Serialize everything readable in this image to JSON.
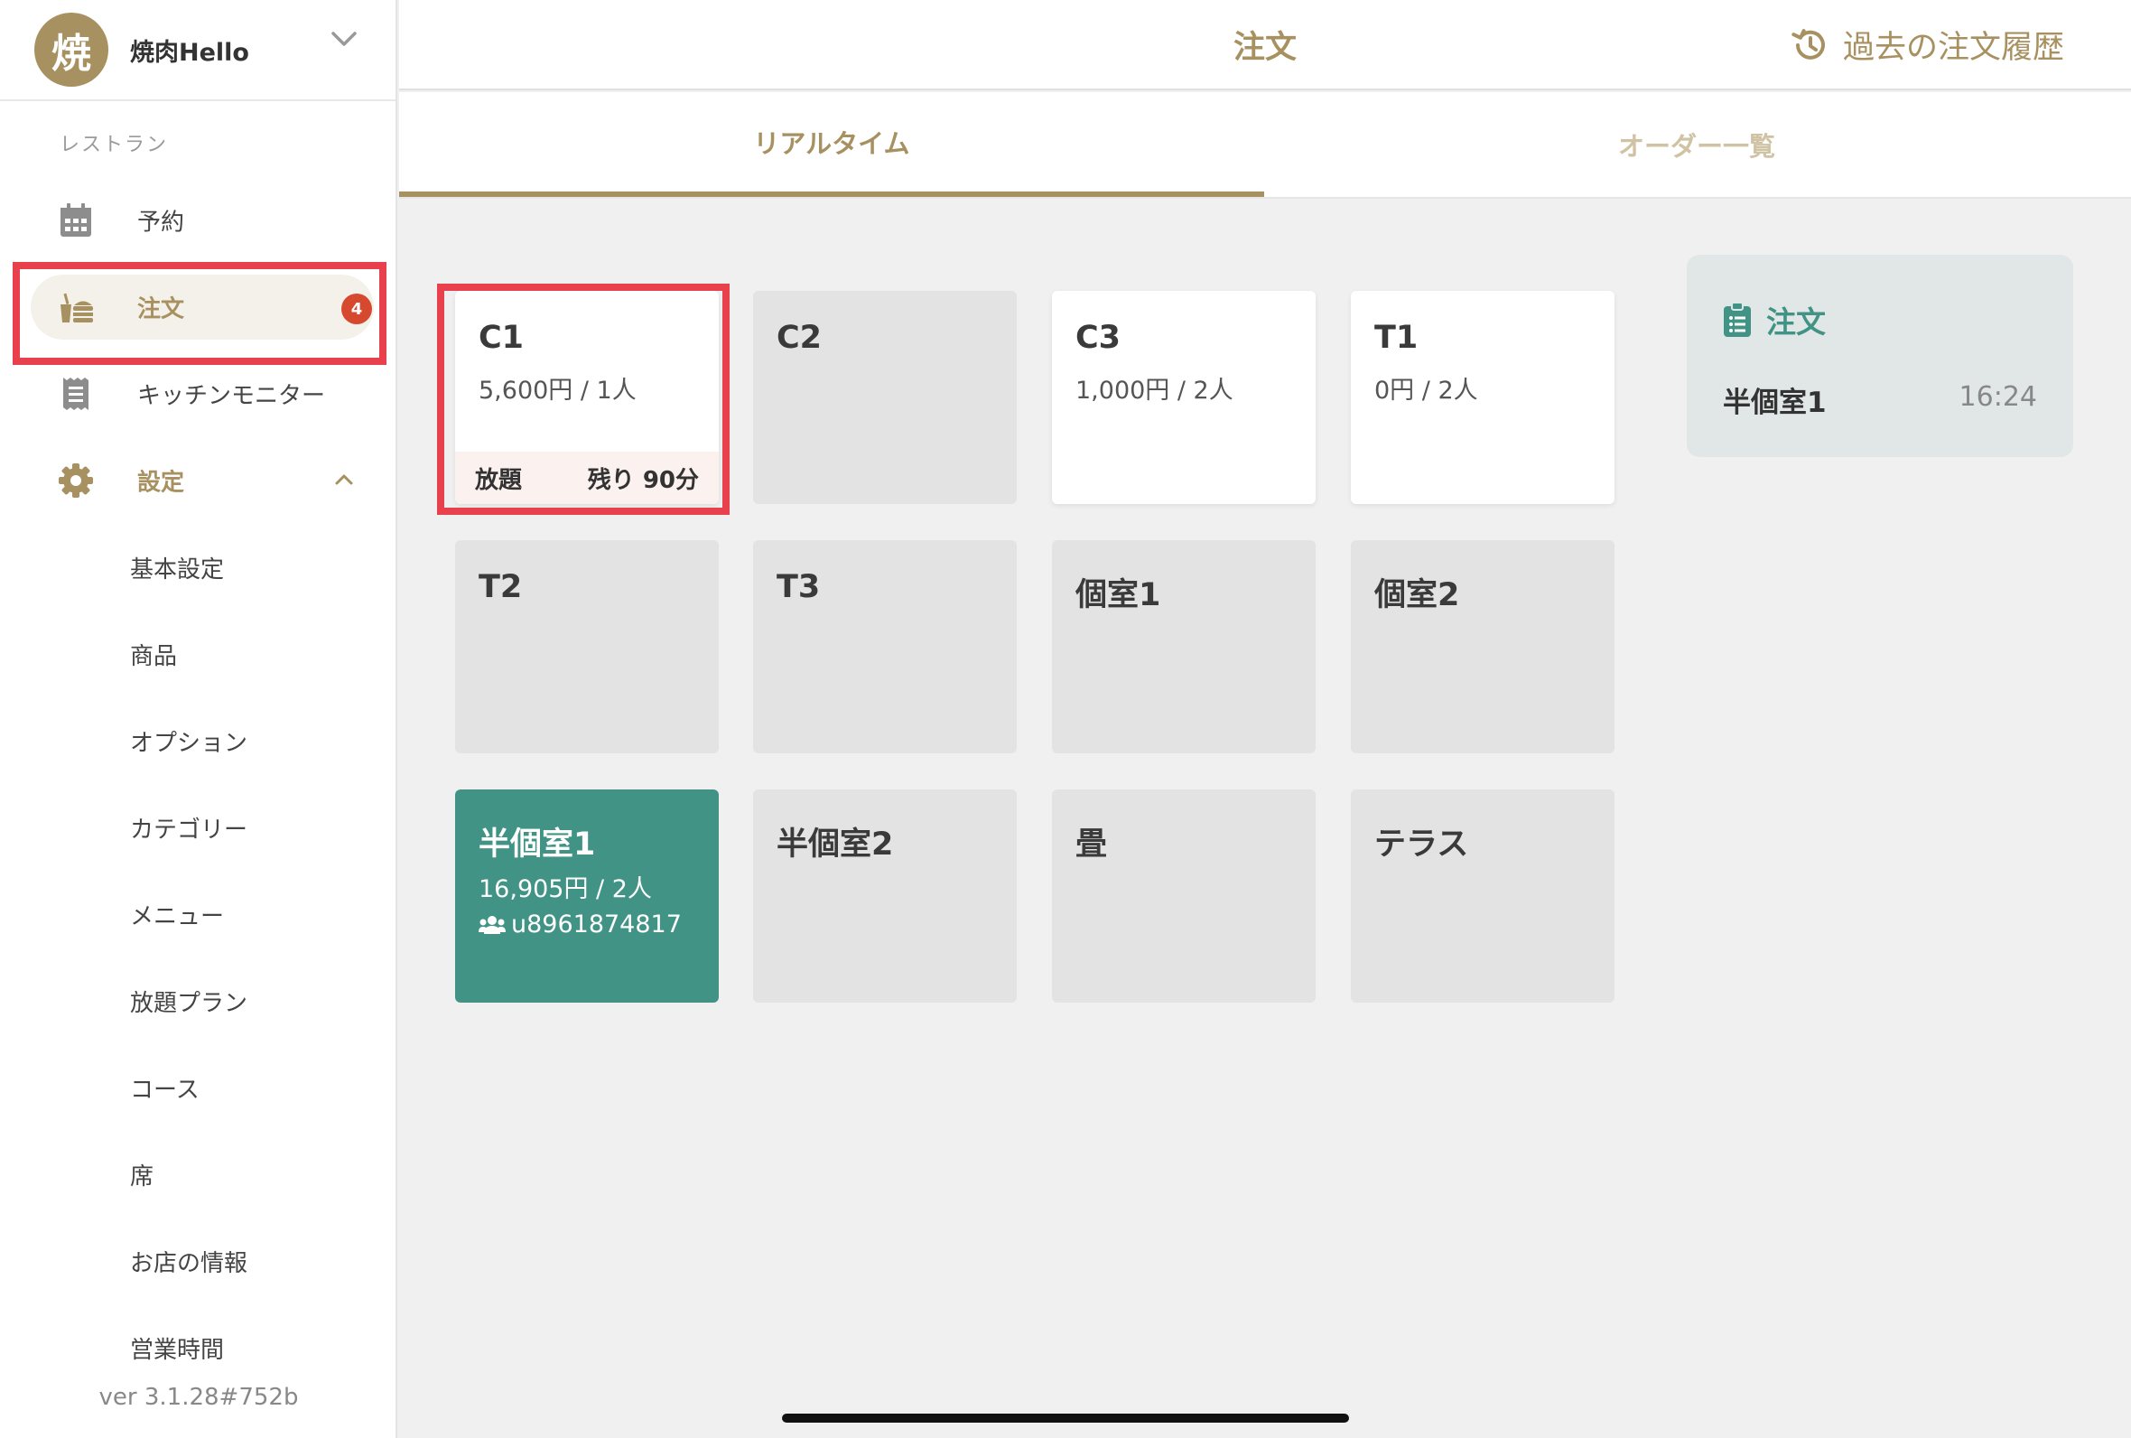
{
  "restaurant": {
    "avatar_char": "焼",
    "name": "焼肉Hello"
  },
  "sidebar": {
    "section_label": "レストラン",
    "items": [
      {
        "label": "予約",
        "icon": "calendar-icon"
      },
      {
        "label": "注文",
        "icon": "order-basket-icon",
        "badge": "4"
      },
      {
        "label": "キッチンモニター",
        "icon": "receipt-icon"
      },
      {
        "label": "設定",
        "icon": "gear-icon"
      }
    ],
    "settings_sub": [
      "基本設定",
      "商品",
      "オプション",
      "カテゴリー",
      "メニュー",
      "放題プラン",
      "コース",
      "席",
      "お店の情報",
      "営業時間"
    ],
    "version": "ver 3.1.28#752b"
  },
  "header": {
    "title": "注文",
    "history_label": "過去の注文履歴"
  },
  "tabs": [
    {
      "label": "リアルタイム"
    },
    {
      "label": "オーダー一覧"
    }
  ],
  "tables": [
    {
      "name": "C1",
      "info": "5,600円 / 1人",
      "footer_left": "放題",
      "footer_right": "残り 90分"
    },
    {
      "name": "C2"
    },
    {
      "name": "C3",
      "info": "1,000円 / 2人"
    },
    {
      "name": "T1",
      "info": "0円 / 2人"
    },
    {
      "name": "T2"
    },
    {
      "name": "T3"
    },
    {
      "name": "個室1"
    },
    {
      "name": "個室2"
    },
    {
      "name": "半個室1",
      "info": "16,905円 / 2人",
      "user": "u8961874817"
    },
    {
      "name": "半個室2"
    },
    {
      "name": "畳"
    },
    {
      "name": "テラス"
    }
  ],
  "order_panel": {
    "title": "注文",
    "table": "半個室1",
    "time": "16:24"
  },
  "colors": {
    "gold": "#a89160",
    "teal": "#419386",
    "highlight": "#e8404c",
    "badge": "#d6492f"
  }
}
